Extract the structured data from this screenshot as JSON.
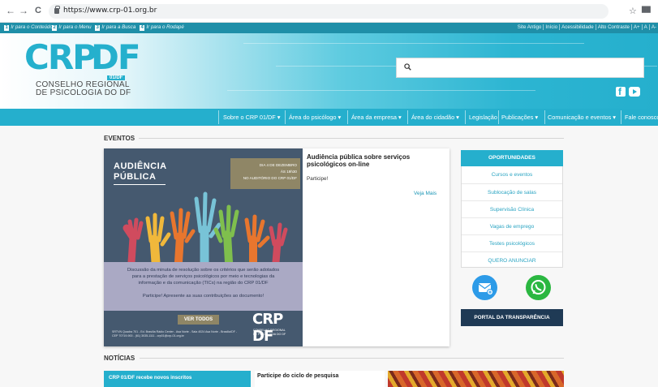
{
  "browser": {
    "url": "https://www.crp-01.org.br",
    "back": "←",
    "forward": "→",
    "reload": "C",
    "star": "☆",
    "profile": "██"
  },
  "skip_links": [
    {
      "num": "1",
      "label": "Ir para o Conteúdo"
    },
    {
      "num": "2",
      "label": "Ir para o Menu"
    },
    {
      "num": "3",
      "label": "Ir para a Busca"
    },
    {
      "num": "4",
      "label": "Ir para o Rodapé"
    }
  ],
  "accessibility": [
    "Site Antigo",
    "Início",
    "Acessibilidade",
    "Alto Contraste",
    "A+",
    "A",
    "A-"
  ],
  "logo": {
    "crp": "CRP",
    "df": "DF",
    "region": "01/DF",
    "line1": "CONSELHO REGIONAL",
    "line2": "DE PSICOLOGIA DO DF"
  },
  "search": {
    "placeholder": ""
  },
  "social": [
    "facebook-icon",
    "youtube-icon"
  ],
  "nav": [
    "Sobre o CRP 01/DF ▾",
    "Área do psicólogo ▾",
    "Área da empresa ▾",
    "Área do cidadão ▾",
    "Legislação",
    "Publicações ▾",
    "Comunicação e eventos ▾",
    "Fale conosco"
  ],
  "eventos": {
    "heading": "EVENTOS",
    "image": {
      "title1": "AUDIÊNCIA",
      "title2": "PÚBLICA",
      "date1": "DIA 4 DE DEZEMBRO",
      "date2": "ÀS 19h30",
      "date3": "NO AUDITÓRIO DO CRP 01/DF",
      "desc1": "Discussão da minuta de resolução sobre os critérios que serão adotados",
      "desc2": "para a prestação de serviços psicológicos por meio e tecnologias da",
      "desc3": "informação e da comunicação (TICs) na região do CRP 01/DF",
      "desc4": "Participe! Apresente as suas contribuições ao documento!",
      "button": "VER TODOS",
      "address": "SRTVN Quadra 701 - Ed. Brasília Rádio Center - Asa Norte - Sala 4024 Asa Norte - Brasília/DF - CEP 70719-900 - (61) 3035-1111 - crp01@crp-01.org.br",
      "logo": "CRP DF",
      "logo_sub1": "CONSELHO REGIONAL",
      "logo_sub2": "DE PSICOLOGIA DO DF"
    },
    "title": "Audiência pública sobre serviços psicológicos on-line",
    "body": "Participe!",
    "more": "Veja Mais"
  },
  "oportunidades": {
    "heading": "OPORTUNIDADES",
    "items": [
      "Cursos e eventos",
      "Sublocação de salas",
      "Supervisão Clínica",
      "Vagas de emprego",
      "Testes psicológicos",
      "QUERO ANUNCIAR"
    ]
  },
  "transparencia": "PORTAL DA TRANSPARÊNCIA",
  "noticias": {
    "heading": "NOTÍCIAS",
    "item1": "CRP 01/DF recebe novos inscritos",
    "item2_line1": "Participe do ciclo de pesquisa",
    "item2_line2": ""
  },
  "colors": {
    "brand": "#25afcd",
    "dark_navy": "#1f3a55",
    "whatsapp": "#2bb741",
    "mail": "#2d9be8"
  }
}
